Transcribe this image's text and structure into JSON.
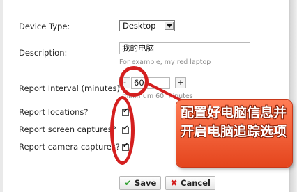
{
  "form": {
    "device_type_label": "Device Type:",
    "device_type_value": "Desktop",
    "description_label": "Description:",
    "description_value": "我的电脑",
    "description_hint": "For example, my red laptop",
    "report_interval_label": "Report Interval (minutes)",
    "report_interval_value": "60",
    "decrement_label": "-",
    "increment_label": "+",
    "interval_hint": "minimum 60 minutes",
    "report_locations_label": "Report locations?",
    "report_screen_label": "Report screen captures?",
    "report_camera_label": "Report camera captures?",
    "report_locations_checked": true,
    "report_screen_checked": true,
    "report_camera_checked": true
  },
  "buttons": {
    "save_label": "Save",
    "cancel_label": "Cancel"
  },
  "annotation": {
    "callout_text": "配置好电脑信息并开启电脑追踪选项",
    "highlight_color": "#d41f1f"
  },
  "icons": [
    "dropdown-arrow-icon",
    "checkmark-icon",
    "x-icon"
  ]
}
